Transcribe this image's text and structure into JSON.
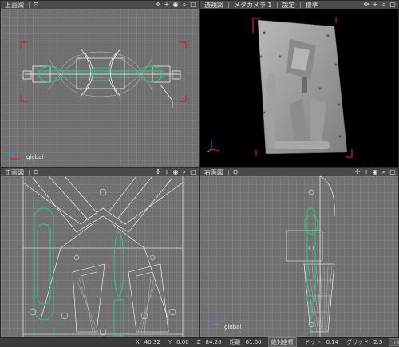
{
  "viewports": {
    "top": {
      "title": "上面図",
      "global_label": "global"
    },
    "persp": {
      "title": "透視図",
      "camera": "メタカメラ 1",
      "settings": "設定",
      "standard": "標準"
    },
    "front": {
      "title": "正面図",
      "global_label": "global"
    },
    "side": {
      "title": "右面図",
      "global_label": "global"
    }
  },
  "header_icons": [
    "move-icon",
    "zoom-icon",
    "search-icon",
    "maximize-icon"
  ],
  "status": {
    "x_label": "X",
    "x_value": "40.32",
    "y_label": "Y",
    "y_value": "0.00",
    "z_label": "Z",
    "z_value": "84.26",
    "dist_label": "距離",
    "dist_value": "61.00",
    "mode_value": "絶対座標",
    "dot_label": "ドット",
    "dot_value": "0.14",
    "grid_label": "グリッド",
    "grid_value": "2.5",
    "unit_value": "mm"
  },
  "colors": {
    "wire": "#ffffff",
    "accent": "#2fcf7f",
    "red": "#d02020",
    "axis_blue": "#3060ff"
  }
}
